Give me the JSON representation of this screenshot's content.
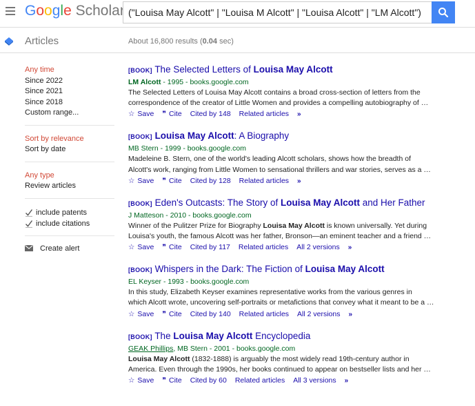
{
  "header": {
    "logo_letters": [
      "G",
      "o",
      "o",
      "g",
      "l",
      "e"
    ],
    "logo_suffix": "Scholar",
    "search_value": "(\"Louisa May Alcott\" | \"Louisa M Alcott\" | \"Louisa Alcott\" | \"LM Alcott\")"
  },
  "subheader": {
    "section_label": "Articles",
    "stats_prefix": "About 16,800 results (",
    "stats_time": "0.04",
    "stats_suffix": " sec)"
  },
  "sidebar": {
    "time_filters": [
      "Any time",
      "Since 2022",
      "Since 2021",
      "Since 2018",
      "Custom range..."
    ],
    "sort_options": [
      "Sort by relevance",
      "Sort by date"
    ],
    "type_options": [
      "Any type",
      "Review articles"
    ],
    "checkboxes": [
      "include patents",
      "include citations"
    ],
    "create_alert": "Create alert"
  },
  "results": [
    {
      "tag": "[BOOK]",
      "title_pre": "The Selected Letters of ",
      "title_bold": "Louisa May Alcott",
      "title_post": "",
      "meta_author_bold": "LM Alcott",
      "meta_rest": " - 1995 - books.google.com",
      "snippet_line1": "The Selected Letters of Louisa May Alcott contains a broad cross-section of letters from the",
      "snippet_line2": "correspondence of the creator of Little Women and provides a compelling autobiography of …",
      "save": "Save",
      "cite": "Cite",
      "cited_by": "Cited by 148",
      "related": "Related articles",
      "versions": ""
    },
    {
      "tag": "[BOOK]",
      "title_pre": "",
      "title_bold": "Louisa May Alcott",
      "title_post": ": A Biography",
      "meta_author_bold": "",
      "meta_rest": "MB Stern - 1999 - books.google.com",
      "snippet_line1": "Madeleine B. Stern, one of the world's leading Alcott scholars, shows how the breadth of",
      "snippet_line2": "Alcott's work, ranging from Little Women to sensational thrillers and war stories, serves as a …",
      "save": "Save",
      "cite": "Cite",
      "cited_by": "Cited by 128",
      "related": "Related articles",
      "versions": ""
    },
    {
      "tag": "[BOOK]",
      "title_pre": "Eden's Outcasts: The Story of ",
      "title_bold": "Louisa May Alcott",
      "title_post": " and Her Father",
      "meta_author_bold": "",
      "meta_rest": "J Matteson - 2010 - books.google.com",
      "snippet_line1_pre": "Winner of the Pulitzer Prize for Biography ",
      "snippet_line1_bold": "Louisa May Alcott",
      "snippet_line1_post": " is known universally. Yet during",
      "snippet_line2": "Louisa's youth, the famous Alcott was her father, Bronson—an eminent teacher and a friend …",
      "save": "Save",
      "cite": "Cite",
      "cited_by": "Cited by 117",
      "related": "Related articles",
      "versions": "All 2 versions"
    },
    {
      "tag": "[BOOK]",
      "title_pre": "Whispers in the Dark: The Fiction of ",
      "title_bold": "Louisa May Alcott",
      "title_post": "",
      "meta_author_bold": "",
      "meta_rest": "EL Keyser - 1993 - books.google.com",
      "snippet_line1": "In this study, Elizabeth Keyser examines representative works from the various genres in",
      "snippet_line2": "which Alcott wrote, uncovering self-portraits or metafictions that convey what it meant to be a …",
      "save": "Save",
      "cite": "Cite",
      "cited_by": "Cited by 140",
      "related": "Related articles",
      "versions": "All 2 versions"
    },
    {
      "tag": "[BOOK]",
      "title_pre": "The ",
      "title_bold": "Louisa May Alcott",
      "title_post": " Encyclopedia",
      "meta_link": "GEAK Phillips",
      "meta_rest": ", MB Stern - 2001 - books.google.com",
      "snippet_line1_bold": "Louisa May Alcott",
      "snippet_line1_post": " (1832-1888) is arguably the most widely read 19th-century author in",
      "snippet_line2": "America. Even through the 1990s, her books continued to appear on bestseller lists and her …",
      "save": "Save",
      "cite": "Cite",
      "cited_by": "Cited by 60",
      "related": "Related articles",
      "versions": "All 3 versions"
    }
  ],
  "colors": {
    "link": "#1a0dab",
    "meta_green": "#006621",
    "selected_red": "#d14836",
    "search_blue": "#4285f4"
  }
}
